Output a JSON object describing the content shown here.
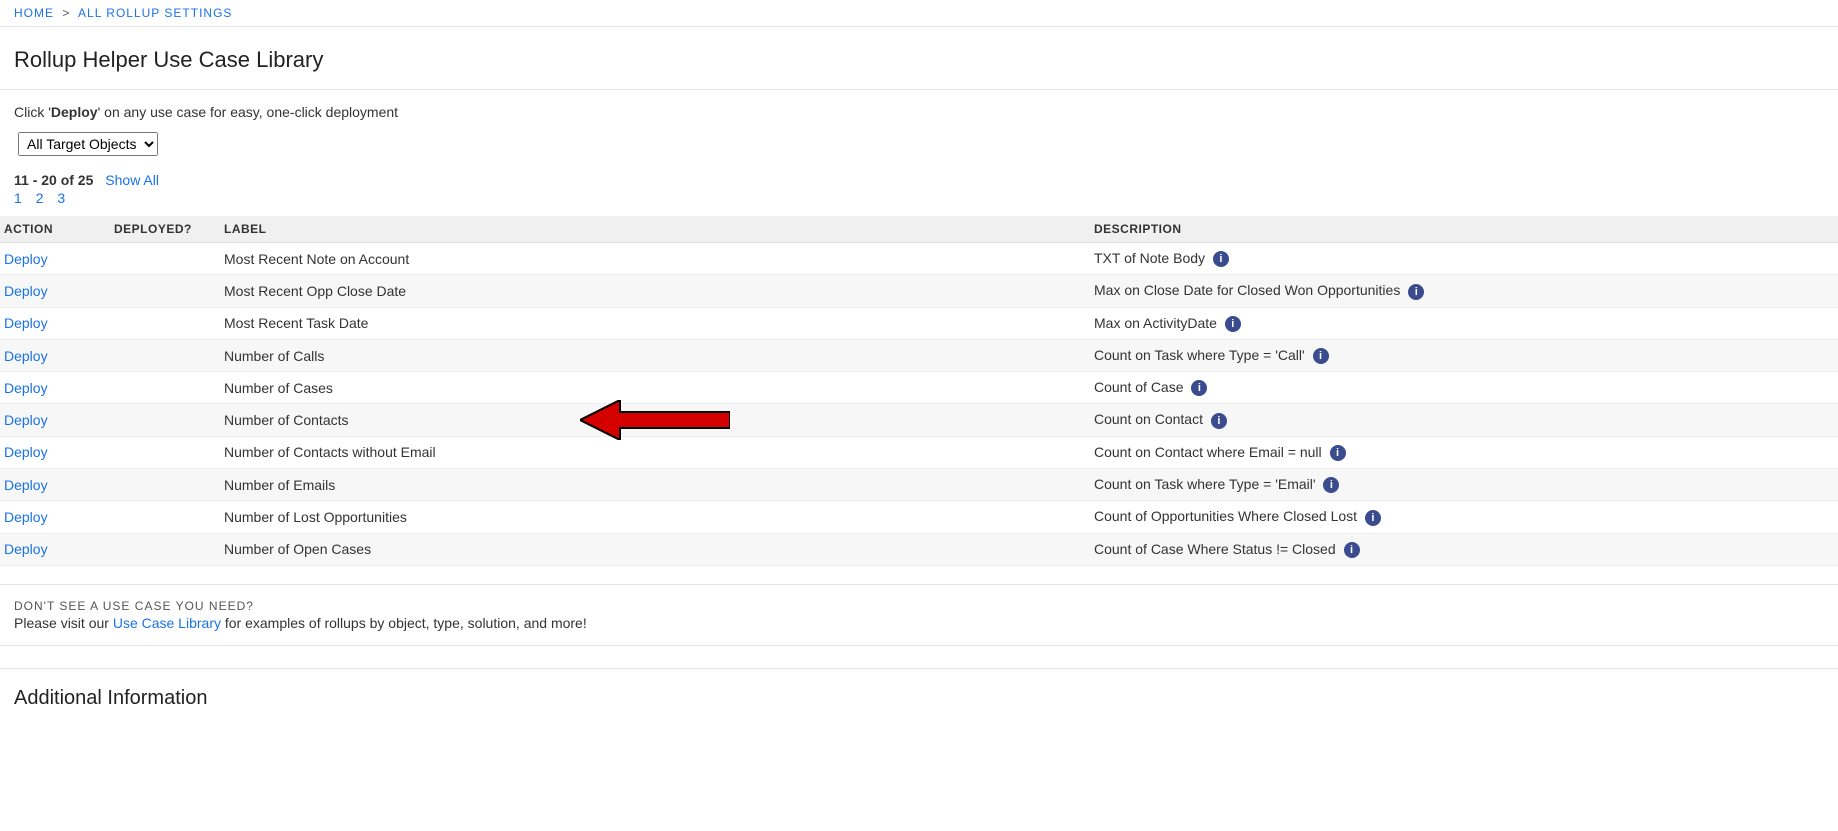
{
  "breadcrumb": {
    "home": "HOME",
    "sep": ">",
    "all_settings": "ALL ROLLUP SETTINGS"
  },
  "page_title": "Rollup Helper Use Case Library",
  "intro": {
    "prefix": "Click '",
    "bold": "Deploy",
    "suffix": "' on any use case for easy, one-click deployment"
  },
  "target_select": "All Target Objects",
  "range": "11 - 20 of 25",
  "show_all": "Show All",
  "pages": [
    "1",
    "2",
    "3"
  ],
  "columns": {
    "action": "Action",
    "deployed": "Deployed?",
    "label": "Label",
    "description": "Description"
  },
  "deploy_label": "Deploy",
  "rows": [
    {
      "label": "Most Recent Note on Account",
      "desc": "TXT of Note Body"
    },
    {
      "label": "Most Recent Opp Close Date",
      "desc": "Max on Close Date for Closed Won Opportunities"
    },
    {
      "label": "Most Recent Task Date",
      "desc": "Max on ActivityDate"
    },
    {
      "label": "Number of Calls",
      "desc": "Count on Task where Type = 'Call'"
    },
    {
      "label": "Number of Cases",
      "desc": "Count of Case"
    },
    {
      "label": "Number of Contacts",
      "desc": "Count on Contact",
      "arrow": true
    },
    {
      "label": "Number of Contacts without Email",
      "desc": "Count on Contact where Email = null"
    },
    {
      "label": "Number of Emails",
      "desc": "Count on Task where Type = 'Email'"
    },
    {
      "label": "Number of Lost Opportunities",
      "desc": "Count of Opportunities Where Closed Lost"
    },
    {
      "label": "Number of Open Cases",
      "desc": "Count of Case Where Status != Closed"
    }
  ],
  "footer": {
    "heading": "DON'T SEE A USE CASE YOU NEED?",
    "prefix": "Please visit our ",
    "link": "Use Case Library",
    "suffix": " for examples of rollups by object, type, solution, and more!"
  },
  "additional": "Additional Information",
  "info_glyph": "i"
}
